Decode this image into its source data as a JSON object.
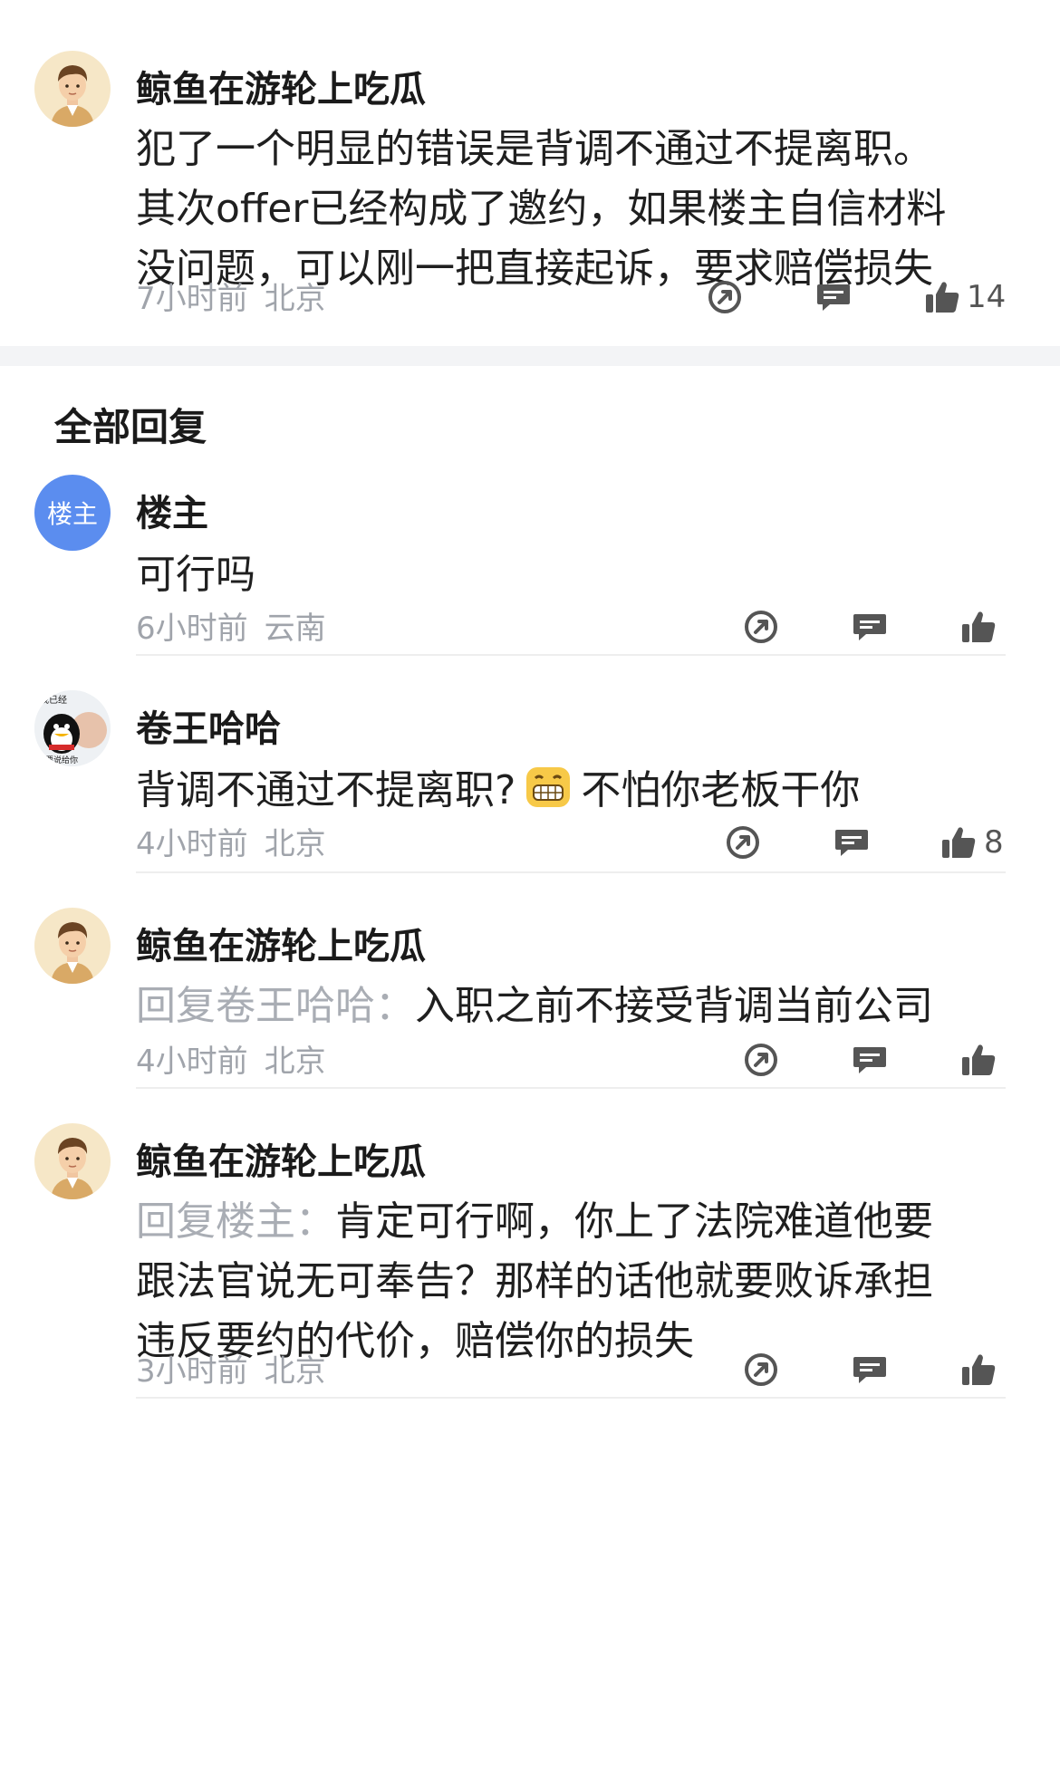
{
  "main_comment": {
    "author": "鲸鱼在游轮上吃瓜",
    "lines": [
      "犯了一个明显的错误是背调不通过不提离职。",
      "其次offer已经构成了邀约，如果楼主自信材料",
      "没问题，可以刚一把直接起诉，要求赔偿损失"
    ],
    "time": "7小时前",
    "location": "北京",
    "like_count": "14"
  },
  "section_title": "全部回复",
  "replies": [
    {
      "author": "楼主",
      "avatar_text": "楼主",
      "text": "可行吗",
      "time": "6小时前",
      "location": "云南",
      "like_count": ""
    },
    {
      "author": "卷王哈哈",
      "avatar_text_top": "我已经",
      "avatar_text_bottom": "要说给你",
      "text_before": "背调不通过不提离职?",
      "text_after": "不怕你老板干你",
      "time": "4小时前",
      "location": "北京",
      "like_count": "8"
    },
    {
      "author": "鲸鱼在游轮上吃瓜",
      "reply_prefix": "回复卷王哈哈：",
      "text": "入职之前不接受背调当前公司",
      "time": "4小时前",
      "location": "北京",
      "like_count": ""
    },
    {
      "author": "鲸鱼在游轮上吃瓜",
      "reply_prefix": "回复楼主：",
      "lines": [
        "肯定可行啊，你上了法院难道他要",
        "跟法官说无可奉告？那样的话他就要败诉承担",
        "违反要约的代价，赔偿你的损失"
      ],
      "time": "3小时前",
      "location": "北京",
      "like_count": ""
    }
  ],
  "icons": {
    "share": "share-icon",
    "comment": "comment-icon",
    "like": "thumbs-up-icon"
  },
  "colors": {
    "meta_gray": "#a0a4ab",
    "blue_avatar": "#5b8def",
    "divider": "#eeeeee"
  }
}
